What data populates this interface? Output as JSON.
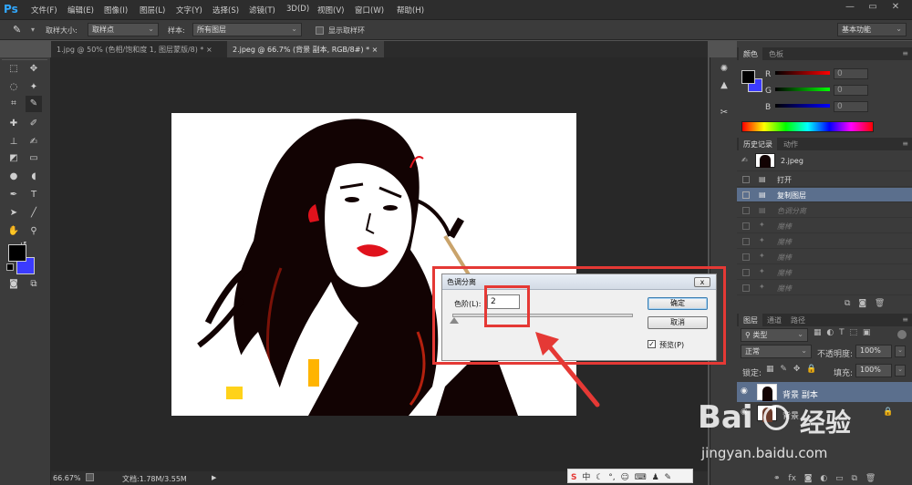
{
  "app": {
    "logo": "Ps"
  },
  "menu": [
    "文件(F)",
    "编辑(E)",
    "图像(I)",
    "图层(L)",
    "文字(Y)",
    "选择(S)",
    "滤镜(T)",
    "3D(D)",
    "视图(V)",
    "窗口(W)",
    "帮助(H)"
  ],
  "options": {
    "sample_size_label": "取样大小:",
    "sample_size_value": "取样点",
    "sample_label": "样本:",
    "sample_value": "所有图层",
    "show_ring_label": "显示取样环",
    "workspace": "基本功能"
  },
  "tabs": [
    "1.jpg @ 50% (色相/饱和度 1, 图层蒙版/8) *",
    "2.jpeg @ 66.7% (背景 副本, RGB/8#) *"
  ],
  "status": {
    "zoom": "66.67%",
    "doc": "文档:1.78M/3.55M"
  },
  "color_panel": {
    "tabs": [
      "颜色",
      "色板"
    ],
    "channels": [
      {
        "label": "R",
        "value": "0"
      },
      {
        "label": "G",
        "value": "0"
      },
      {
        "label": "B",
        "value": "0"
      }
    ]
  },
  "history_panel": {
    "tabs": [
      "历史记录",
      "动作"
    ],
    "snapshot": "2.jpeg",
    "items": [
      {
        "label": "打开",
        "state": "normal"
      },
      {
        "label": "复制图层",
        "state": "selected"
      },
      {
        "label": "色调分离",
        "state": "dim"
      },
      {
        "label": "魔棒",
        "state": "dim"
      },
      {
        "label": "魔棒",
        "state": "dim"
      },
      {
        "label": "魔棒",
        "state": "dim"
      },
      {
        "label": "魔棒",
        "state": "dim"
      },
      {
        "label": "魔棒",
        "state": "dim"
      }
    ]
  },
  "layers_panel": {
    "tabs": [
      "图层",
      "通道",
      "路径"
    ],
    "filter": "类型",
    "blend_mode": "正常",
    "opacity_label": "不透明度:",
    "opacity_value": "100%",
    "lock_label": "锁定:",
    "fill_label": "填充:",
    "fill_value": "100%",
    "layers": [
      {
        "name": "背景 副本"
      },
      {
        "name": "背景"
      }
    ]
  },
  "dialog": {
    "title": "色调分离",
    "close": "x",
    "levels_label": "色阶(L):",
    "levels_value": "2",
    "ok": "确定",
    "cancel": "取消",
    "preview_label": "预览(P)",
    "preview_checked": true
  },
  "watermark": {
    "brand": "Bai",
    "brand2": "经验",
    "url": "jingyan.baidu.com"
  },
  "colors": {
    "foreground": "#000000",
    "background": "#3b3bff",
    "accent_red": "#e53935"
  }
}
